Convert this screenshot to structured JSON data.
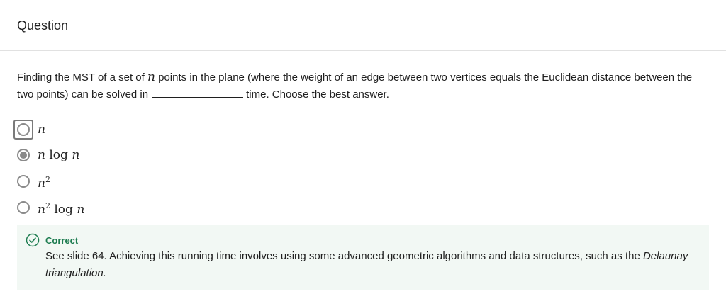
{
  "header": {
    "title": "Question"
  },
  "question": {
    "part1": "Finding the MST of a set of",
    "var": "n",
    "part2": "points in the plane (where the weight of an edge between two vertices equals the Euclidean distance between the two points) can be solved in",
    "part3": "time. Choose the best answer."
  },
  "options": [
    {
      "id": "opt-n",
      "base": "n",
      "exp": "",
      "log": "",
      "logvar": "",
      "selected": false,
      "focused": true
    },
    {
      "id": "opt-nlogn",
      "base": "n",
      "exp": "",
      "log": "log",
      "logvar": "n",
      "selected": true,
      "focused": false
    },
    {
      "id": "opt-n2",
      "base": "n",
      "exp": "2",
      "log": "",
      "logvar": "",
      "selected": false,
      "focused": false
    },
    {
      "id": "opt-n2logn",
      "base": "n",
      "exp": "2",
      "log": "log",
      "logvar": "n",
      "selected": false,
      "focused": false
    }
  ],
  "feedback": {
    "status": "Correct",
    "text_part1": "See slide 64. Achieving this running time involves using some advanced geometric algorithms and data structures, such as the",
    "text_italic": "Delaunay triangulation.",
    "status_color": "#1d7c50",
    "background_color": "#f2f8f4",
    "icon": "check-circle-icon"
  }
}
